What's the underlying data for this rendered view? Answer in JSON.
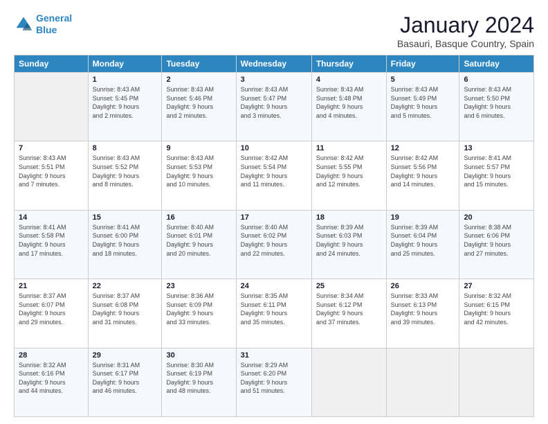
{
  "logo": {
    "line1": "General",
    "line2": "Blue"
  },
  "title": "January 2024",
  "location": "Basauri, Basque Country, Spain",
  "headers": [
    "Sunday",
    "Monday",
    "Tuesday",
    "Wednesday",
    "Thursday",
    "Friday",
    "Saturday"
  ],
  "weeks": [
    [
      {
        "day": "",
        "info": ""
      },
      {
        "day": "1",
        "info": "Sunrise: 8:43 AM\nSunset: 5:45 PM\nDaylight: 9 hours\nand 2 minutes."
      },
      {
        "day": "2",
        "info": "Sunrise: 8:43 AM\nSunset: 5:46 PM\nDaylight: 9 hours\nand 2 minutes."
      },
      {
        "day": "3",
        "info": "Sunrise: 8:43 AM\nSunset: 5:47 PM\nDaylight: 9 hours\nand 3 minutes."
      },
      {
        "day": "4",
        "info": "Sunrise: 8:43 AM\nSunset: 5:48 PM\nDaylight: 9 hours\nand 4 minutes."
      },
      {
        "day": "5",
        "info": "Sunrise: 8:43 AM\nSunset: 5:49 PM\nDaylight: 9 hours\nand 5 minutes."
      },
      {
        "day": "6",
        "info": "Sunrise: 8:43 AM\nSunset: 5:50 PM\nDaylight: 9 hours\nand 6 minutes."
      }
    ],
    [
      {
        "day": "7",
        "info": "Sunrise: 8:43 AM\nSunset: 5:51 PM\nDaylight: 9 hours\nand 7 minutes."
      },
      {
        "day": "8",
        "info": "Sunrise: 8:43 AM\nSunset: 5:52 PM\nDaylight: 9 hours\nand 8 minutes."
      },
      {
        "day": "9",
        "info": "Sunrise: 8:43 AM\nSunset: 5:53 PM\nDaylight: 9 hours\nand 10 minutes."
      },
      {
        "day": "10",
        "info": "Sunrise: 8:42 AM\nSunset: 5:54 PM\nDaylight: 9 hours\nand 11 minutes."
      },
      {
        "day": "11",
        "info": "Sunrise: 8:42 AM\nSunset: 5:55 PM\nDaylight: 9 hours\nand 12 minutes."
      },
      {
        "day": "12",
        "info": "Sunrise: 8:42 AM\nSunset: 5:56 PM\nDaylight: 9 hours\nand 14 minutes."
      },
      {
        "day": "13",
        "info": "Sunrise: 8:41 AM\nSunset: 5:57 PM\nDaylight: 9 hours\nand 15 minutes."
      }
    ],
    [
      {
        "day": "14",
        "info": "Sunrise: 8:41 AM\nSunset: 5:58 PM\nDaylight: 9 hours\nand 17 minutes."
      },
      {
        "day": "15",
        "info": "Sunrise: 8:41 AM\nSunset: 6:00 PM\nDaylight: 9 hours\nand 18 minutes."
      },
      {
        "day": "16",
        "info": "Sunrise: 8:40 AM\nSunset: 6:01 PM\nDaylight: 9 hours\nand 20 minutes."
      },
      {
        "day": "17",
        "info": "Sunrise: 8:40 AM\nSunset: 6:02 PM\nDaylight: 9 hours\nand 22 minutes."
      },
      {
        "day": "18",
        "info": "Sunrise: 8:39 AM\nSunset: 6:03 PM\nDaylight: 9 hours\nand 24 minutes."
      },
      {
        "day": "19",
        "info": "Sunrise: 8:39 AM\nSunset: 6:04 PM\nDaylight: 9 hours\nand 25 minutes."
      },
      {
        "day": "20",
        "info": "Sunrise: 8:38 AM\nSunset: 6:06 PM\nDaylight: 9 hours\nand 27 minutes."
      }
    ],
    [
      {
        "day": "21",
        "info": "Sunrise: 8:37 AM\nSunset: 6:07 PM\nDaylight: 9 hours\nand 29 minutes."
      },
      {
        "day": "22",
        "info": "Sunrise: 8:37 AM\nSunset: 6:08 PM\nDaylight: 9 hours\nand 31 minutes."
      },
      {
        "day": "23",
        "info": "Sunrise: 8:36 AM\nSunset: 6:09 PM\nDaylight: 9 hours\nand 33 minutes."
      },
      {
        "day": "24",
        "info": "Sunrise: 8:35 AM\nSunset: 6:11 PM\nDaylight: 9 hours\nand 35 minutes."
      },
      {
        "day": "25",
        "info": "Sunrise: 8:34 AM\nSunset: 6:12 PM\nDaylight: 9 hours\nand 37 minutes."
      },
      {
        "day": "26",
        "info": "Sunrise: 8:33 AM\nSunset: 6:13 PM\nDaylight: 9 hours\nand 39 minutes."
      },
      {
        "day": "27",
        "info": "Sunrise: 8:32 AM\nSunset: 6:15 PM\nDaylight: 9 hours\nand 42 minutes."
      }
    ],
    [
      {
        "day": "28",
        "info": "Sunrise: 8:32 AM\nSunset: 6:16 PM\nDaylight: 9 hours\nand 44 minutes."
      },
      {
        "day": "29",
        "info": "Sunrise: 8:31 AM\nSunset: 6:17 PM\nDaylight: 9 hours\nand 46 minutes."
      },
      {
        "day": "30",
        "info": "Sunrise: 8:30 AM\nSunset: 6:19 PM\nDaylight: 9 hours\nand 48 minutes."
      },
      {
        "day": "31",
        "info": "Sunrise: 8:29 AM\nSunset: 6:20 PM\nDaylight: 9 hours\nand 51 minutes."
      },
      {
        "day": "",
        "info": ""
      },
      {
        "day": "",
        "info": ""
      },
      {
        "day": "",
        "info": ""
      }
    ]
  ]
}
